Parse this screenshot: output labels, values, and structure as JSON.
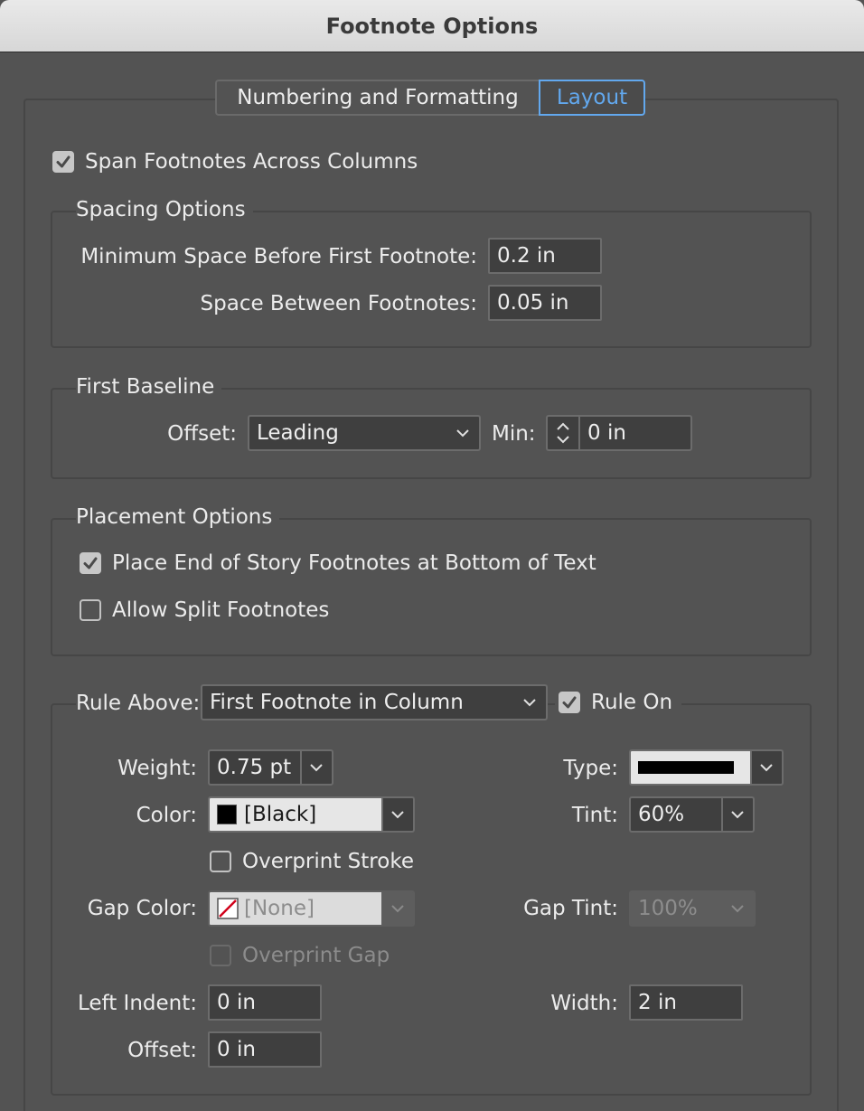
{
  "window": {
    "title": "Footnote Options"
  },
  "tabs": [
    {
      "label": "Numbering and Formatting",
      "active": false
    },
    {
      "label": "Layout",
      "active": true
    }
  ],
  "span_columns": {
    "label": "Span Footnotes Across Columns",
    "checked": true
  },
  "spacing": {
    "title": "Spacing Options",
    "min_space_label": "Minimum Space Before First Footnote:",
    "min_space_value": "0.2 in",
    "between_label": "Space Between Footnotes:",
    "between_value": "0.05 in"
  },
  "first_baseline": {
    "title": "First Baseline",
    "offset_label": "Offset:",
    "offset_value": "Leading",
    "min_label": "Min:",
    "min_value": "0 in"
  },
  "placement": {
    "title": "Placement Options",
    "end_of_story_label": "Place End of Story Footnotes at Bottom of Text",
    "end_of_story_checked": true,
    "allow_split_label": "Allow Split Footnotes",
    "allow_split_checked": false
  },
  "rule": {
    "rule_above_label": "Rule Above:",
    "rule_above_value": "First Footnote in Column",
    "rule_on_label": "Rule On",
    "rule_on_checked": true,
    "weight_label": "Weight:",
    "weight_value": "0.75 pt",
    "type_label": "Type:",
    "color_label": "Color:",
    "color_value": "[Black]",
    "tint_label": "Tint:",
    "tint_value": "60%",
    "overprint_stroke_label": "Overprint Stroke",
    "overprint_stroke_checked": false,
    "gap_color_label": "Gap Color:",
    "gap_color_value": "[None]",
    "gap_tint_label": "Gap Tint:",
    "gap_tint_value": "100%",
    "overprint_gap_label": "Overprint Gap",
    "overprint_gap_checked": false,
    "left_indent_label": "Left Indent:",
    "left_indent_value": "0 in",
    "width_label": "Width:",
    "width_value": "2 in",
    "offset_label": "Offset:",
    "offset_value": "0 in"
  },
  "colors": {
    "accent": "#62a8ee",
    "panel_bg": "#535353",
    "field_bg": "#3f3f3f",
    "black_swatch": "#000000",
    "none_swatch_slash": "#d0021b"
  },
  "icons": {
    "checkmark": "checkmark-icon",
    "dropdown": "chevron-down-icon",
    "stepper": "stepper-icon",
    "swatch_black": "black-swatch-icon",
    "swatch_none": "none-swatch-icon"
  }
}
